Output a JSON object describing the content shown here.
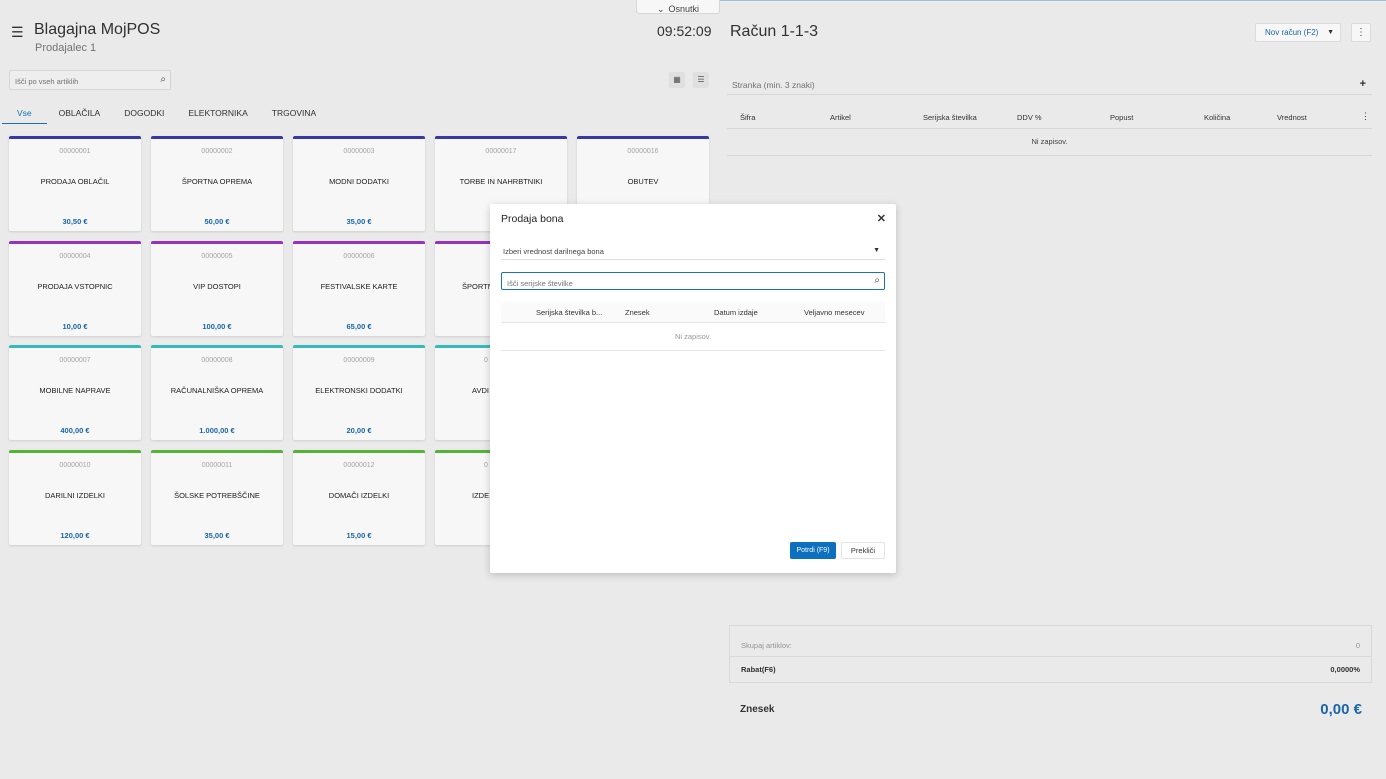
{
  "header": {
    "app_title": "Blagajna MojPOS",
    "seller": "Prodajalec 1",
    "clock": "09:52:09",
    "drafts_label": "Osnutki"
  },
  "search": {
    "placeholder": "Išči po vseh artiklih"
  },
  "tabs": [
    {
      "label": "Vse",
      "active": true
    },
    {
      "label": "OBLAČILA"
    },
    {
      "label": "DOGODKI"
    },
    {
      "label": "ELEKTORNIKA"
    },
    {
      "label": "TRGOVINA"
    }
  ],
  "tiles": [
    {
      "code": "00000001",
      "name": "PRODAJA OBLAČIL",
      "price": "30,50 €",
      "color": "#3a3aa8"
    },
    {
      "code": "00000002",
      "name": "ŠPORTNA OPREMA",
      "price": "50,00 €",
      "color": "#3a3aa8"
    },
    {
      "code": "00000003",
      "name": "MODNI DODATKI",
      "price": "35,00 €",
      "color": "#3a3aa8"
    },
    {
      "code": "00000017",
      "name": "TORBE IN NAHRBTNIKI",
      "price": "",
      "color": "#3a3aa8"
    },
    {
      "code": "00000016",
      "name": "OBUTEV",
      "price": "",
      "color": "#3a3aa8"
    },
    {
      "code": "00000004",
      "name": "PRODAJA VSTOPNIC",
      "price": "10,00 €",
      "color": "#9b35c0"
    },
    {
      "code": "00000005",
      "name": "VIP DOSTOPI",
      "price": "100,00 €",
      "color": "#9b35c0"
    },
    {
      "code": "00000006",
      "name": "FESTIVALSKE KARTE",
      "price": "65,00 €",
      "color": "#9b35c0"
    },
    {
      "code": "",
      "name": "ŠPORTN",
      "price": "",
      "color": "#9b35c0"
    },
    {
      "code": "00000007",
      "name": "MOBILNE NAPRAVE",
      "price": "400,00 €",
      "color": "#36c3c3"
    },
    {
      "code": "00000008",
      "name": "RAČUNALNIŠKA OPREMA",
      "price": "1.000,00 €",
      "color": "#36c3c3"
    },
    {
      "code": "00000009",
      "name": "ELEKTRONSKI DODATKI",
      "price": "20,00 €",
      "color": "#36c3c3"
    },
    {
      "code": "0",
      "name": "AVDI",
      "price": "",
      "color": "#36c3c3"
    },
    {
      "code": "00000010",
      "name": "DARILNI IZDELKI",
      "price": "120,00 €",
      "color": "#5cb83a"
    },
    {
      "code": "00000011",
      "name": "ŠOLSKE POTREBŠČINE",
      "price": "35,00 €",
      "color": "#5cb83a"
    },
    {
      "code": "00000012",
      "name": "DOMAČI IZDELKI",
      "price": "15,00 €",
      "color": "#5cb83a"
    },
    {
      "code": "0",
      "name": "IZDE",
      "price": "",
      "color": "#5cb83a"
    }
  ],
  "bill": {
    "title": "Račun 1-1-3",
    "new_bill_label": "Nov račun (F2)",
    "customer_placeholder": "Stranka (min. 3 znaki)",
    "columns": [
      "Šifra",
      "Artikel",
      "Serijska številka",
      "DDV %",
      "Popust",
      "Količina",
      "Vrednost"
    ],
    "empty_text": "Ni zapisov.",
    "summary": {
      "items_label": "Skupaj artiklov:",
      "items_value": "0",
      "discount_label": "Rabat(F6)",
      "discount_value": "0,0000%"
    },
    "total_label": "Znesek",
    "total_value": "0,00 €"
  },
  "modal": {
    "title": "Prodaja bona",
    "value_select_label": "Izberi vrednost darilnega bona",
    "serial_search_placeholder": "Išči serijske številke",
    "columns": [
      "Serijska številka b...",
      "Znesek",
      "Datum izdaje",
      "Veljavno mesecev"
    ],
    "empty_text": "Ni zapisov.",
    "confirm_label": "Potrdi (F9)",
    "cancel_label": "Prekliči"
  },
  "colors": {
    "accent": "#1a6ab0",
    "confirm": "#0d6fc0",
    "row1": "#3a3aa8",
    "row2": "#9b35c0",
    "row3": "#36c3c3",
    "row4": "#5cb83a"
  }
}
